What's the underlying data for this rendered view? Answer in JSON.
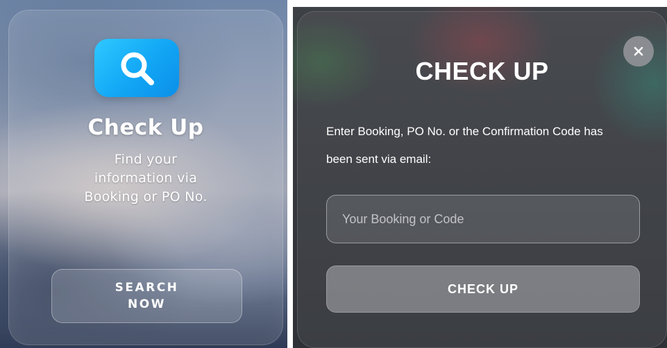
{
  "colors": {
    "icon_tile": "#1aaef7",
    "close_button": "#96969c",
    "check_button": "#aaaab0"
  },
  "left_card": {
    "icon": "magnifier-icon",
    "title": "Check Up",
    "subtitle_lines": [
      "Find your",
      "information via",
      "Booking or PO No."
    ],
    "button_lines": [
      "SEARCH",
      "NOW"
    ]
  },
  "modal": {
    "close_label": "×",
    "title": "CHECK UP",
    "description_lines": [
      "Enter Booking, PO No. or the Confirmation Code has",
      "been sent via email:"
    ],
    "input": {
      "placeholder": "Your Booking or Code",
      "value": ""
    },
    "button_label": "CHECK UP"
  }
}
